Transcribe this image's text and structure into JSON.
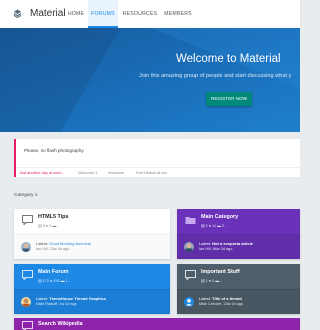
{
  "nav": {
    "brand": "Material",
    "items": [
      "HOME",
      "FORUMS",
      "RESOURCES",
      "MEMBERS"
    ]
  },
  "hero": {
    "title": "Welcome to Material",
    "subtitle": "Join this amazing group of people and start discussing what y",
    "button": "REGISTER NOW"
  },
  "notice": {
    "text": "Please, no flash photography.",
    "links": [
      "Just another day at work...",
      "Welcome 3",
      "Welcome",
      "Don't Blank at me..."
    ]
  },
  "category_label": "Category 1",
  "forums": [
    {
      "title": "HTML5 Tips",
      "stats": "▤ 5  ● 0  ▬ -",
      "latest_prefix": "Latest: ",
      "latest_title": "Good Morning America!",
      "latest_meta": "Ian Hill, 23w 3d ago"
    },
    {
      "title": "Main Category",
      "stats": "▤ 2  ● 11  ▬ 2  -",
      "latest_prefix": "Latest: ",
      "latest_title": "Not a xenporta article",
      "latest_meta": "Ian Hill, 66w 3d ago"
    },
    {
      "title": "Main Forum",
      "stats": "▤ 172  ● 452  ▬ 1  -",
      "latest_prefix": "Latest: ",
      "latest_title": "TheneHouse Thread Graphics",
      "latest_meta": "Nikki Radloff, 1w 2d ago"
    },
    {
      "title": "Important Stuff",
      "stats": "▤ 1  ● 0  ▬ -",
      "latest_prefix": "Latest: ",
      "latest_title": "Title of a thread",
      "latest_meta": "Mike Creuzer, 23w 2d ago"
    },
    {
      "title": "Search Wikipedia",
      "stats": "",
      "latest_prefix": "",
      "latest_title": "",
      "latest_meta": ""
    }
  ],
  "colors": {
    "accent": "#1e88e5",
    "hero_bg": "#1a6fba",
    "register_button": "#00897b",
    "notice_border": "#e91e63",
    "main_category": "#6a32b8",
    "main_forum": "#1e88e5",
    "important_stuff": "#4f5e6b",
    "search_wikipedia": "#8e24aa"
  },
  "icons": [
    "logo-icon",
    "chat-icon",
    "folder-icon",
    "user-icon",
    "avatar"
  ]
}
